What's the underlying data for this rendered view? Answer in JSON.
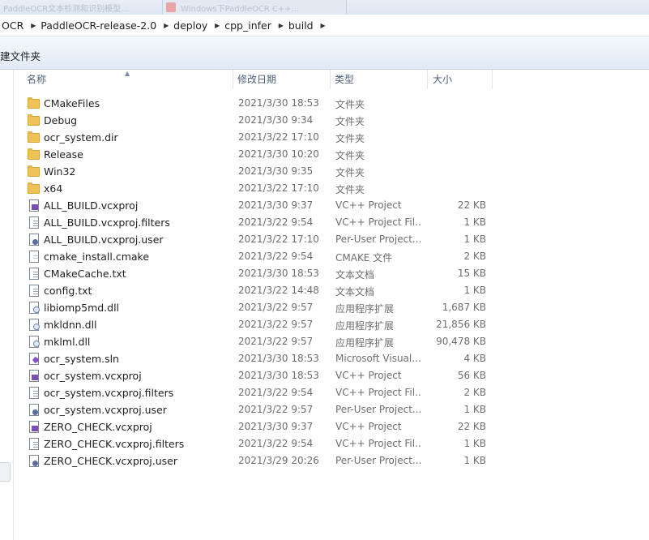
{
  "window": {
    "background_tabs": [
      "PaddleOCR文本检测和识别模型...",
      "Windows下PaddleOCR C++..."
    ]
  },
  "address_bar": {
    "breadcrumbs": [
      "OCR",
      "PaddleOCR-release-2.0",
      "deploy",
      "cpp_infer",
      "build"
    ]
  },
  "toolbar": {
    "new_folder_label": "建文件夹"
  },
  "columns": {
    "name": "名称",
    "date": "修改日期",
    "type": "类型",
    "size": "大小"
  },
  "files": [
    {
      "name": "CMakeFiles",
      "date": "2021/3/30 18:53",
      "type": "文件夹",
      "size": "",
      "icon": "folder-icon"
    },
    {
      "name": "Debug",
      "date": "2021/3/30 9:34",
      "type": "文件夹",
      "size": "",
      "icon": "folder-icon"
    },
    {
      "name": "ocr_system.dir",
      "date": "2021/3/22 17:10",
      "type": "文件夹",
      "size": "",
      "icon": "folder-icon"
    },
    {
      "name": "Release",
      "date": "2021/3/30 10:20",
      "type": "文件夹",
      "size": "",
      "icon": "folder-icon"
    },
    {
      "name": "Win32",
      "date": "2021/3/30 9:35",
      "type": "文件夹",
      "size": "",
      "icon": "folder-icon"
    },
    {
      "name": "x64",
      "date": "2021/3/22 17:10",
      "type": "文件夹",
      "size": "",
      "icon": "folder-icon"
    },
    {
      "name": "ALL_BUILD.vcxproj",
      "date": "2021/3/30 9:37",
      "type": "VC++ Project",
      "size": "22 KB",
      "icon": "vcxproj-icon"
    },
    {
      "name": "ALL_BUILD.vcxproj.filters",
      "date": "2021/3/22 9:54",
      "type": "VC++ Project Fil...",
      "size": "1 KB",
      "icon": "filters-icon"
    },
    {
      "name": "ALL_BUILD.vcxproj.user",
      "date": "2021/3/22 17:10",
      "type": "Per-User Project...",
      "size": "1 KB",
      "icon": "user-file-icon"
    },
    {
      "name": "cmake_install.cmake",
      "date": "2021/3/22 9:54",
      "type": "CMAKE 文件",
      "size": "2 KB",
      "icon": "cmake-file-icon"
    },
    {
      "name": "CMakeCache.txt",
      "date": "2021/3/30 18:53",
      "type": "文本文档",
      "size": "15 KB",
      "icon": "text-file-icon"
    },
    {
      "name": "config.txt",
      "date": "2021/3/22 14:48",
      "type": "文本文档",
      "size": "1 KB",
      "icon": "text-file-icon"
    },
    {
      "name": "libiomp5md.dll",
      "date": "2021/3/22 9:57",
      "type": "应用程序扩展",
      "size": "1,687 KB",
      "icon": "dll-icon"
    },
    {
      "name": "mkldnn.dll",
      "date": "2021/3/22 9:57",
      "type": "应用程序扩展",
      "size": "21,856 KB",
      "icon": "dll-icon"
    },
    {
      "name": "mklml.dll",
      "date": "2021/3/22 9:57",
      "type": "应用程序扩展",
      "size": "90,478 KB",
      "icon": "dll-icon"
    },
    {
      "name": "ocr_system.sln",
      "date": "2021/3/30 18:53",
      "type": "Microsoft Visual...",
      "size": "4 KB",
      "icon": "sln-icon"
    },
    {
      "name": "ocr_system.vcxproj",
      "date": "2021/3/30 18:53",
      "type": "VC++ Project",
      "size": "56 KB",
      "icon": "vcxproj-icon"
    },
    {
      "name": "ocr_system.vcxproj.filters",
      "date": "2021/3/22 9:54",
      "type": "VC++ Project Fil...",
      "size": "2 KB",
      "icon": "filters-icon"
    },
    {
      "name": "ocr_system.vcxproj.user",
      "date": "2021/3/22 9:57",
      "type": "Per-User Project...",
      "size": "1 KB",
      "icon": "user-file-icon"
    },
    {
      "name": "ZERO_CHECK.vcxproj",
      "date": "2021/3/30 9:37",
      "type": "VC++ Project",
      "size": "22 KB",
      "icon": "vcxproj-icon"
    },
    {
      "name": "ZERO_CHECK.vcxproj.filters",
      "date": "2021/3/22 9:54",
      "type": "VC++ Project Fil...",
      "size": "1 KB",
      "icon": "filters-icon"
    },
    {
      "name": "ZERO_CHECK.vcxproj.user",
      "date": "2021/3/29 20:26",
      "type": "Per-User Project...",
      "size": "1 KB",
      "icon": "user-file-icon"
    }
  ]
}
